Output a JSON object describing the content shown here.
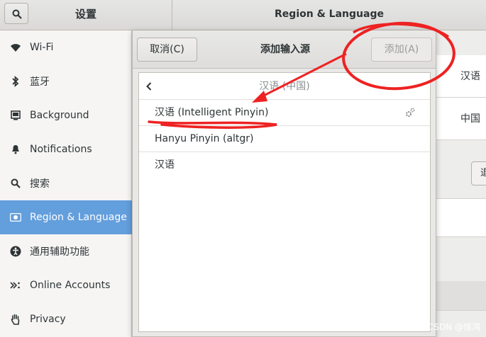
{
  "header": {
    "left_title": "设置",
    "right_title": "Region & Language",
    "search_icon": "search-icon"
  },
  "sidebar": {
    "items": [
      {
        "label": "Wi-Fi",
        "icon": "wifi-icon",
        "active": false
      },
      {
        "label": "蓝牙",
        "icon": "bluetooth-icon",
        "active": false
      },
      {
        "label": "Background",
        "icon": "background-icon",
        "active": false
      },
      {
        "label": "Notifications",
        "icon": "bell-icon",
        "active": false
      },
      {
        "label": "搜索",
        "icon": "search-icon",
        "active": false
      },
      {
        "label": "Region & Language",
        "icon": "region-icon",
        "active": true
      },
      {
        "label": "通用辅助功能",
        "icon": "accessibility-icon",
        "active": false
      },
      {
        "label": "Online Accounts",
        "icon": "online-accounts-icon",
        "active": false
      },
      {
        "label": "Privacy",
        "icon": "hand-icon",
        "active": false
      }
    ]
  },
  "content": {
    "row1_label": "汉语",
    "row2_label": "中国",
    "partial_button": "退"
  },
  "dialog": {
    "cancel_label": "取消(C)",
    "title": "添加输入源",
    "add_label": "添加(A)",
    "list_header": "汉语 (中国)",
    "items": [
      {
        "label": "汉语 (Intelligent Pinyin)",
        "has_settings": true
      },
      {
        "label": "Hanyu Pinyin (altgr)",
        "has_settings": false
      },
      {
        "label": "汉语",
        "has_settings": false
      }
    ]
  },
  "colors": {
    "accent": "#4a90d9",
    "annotation": "#ee2222"
  },
  "watermark": "CSDN @惊鸿"
}
